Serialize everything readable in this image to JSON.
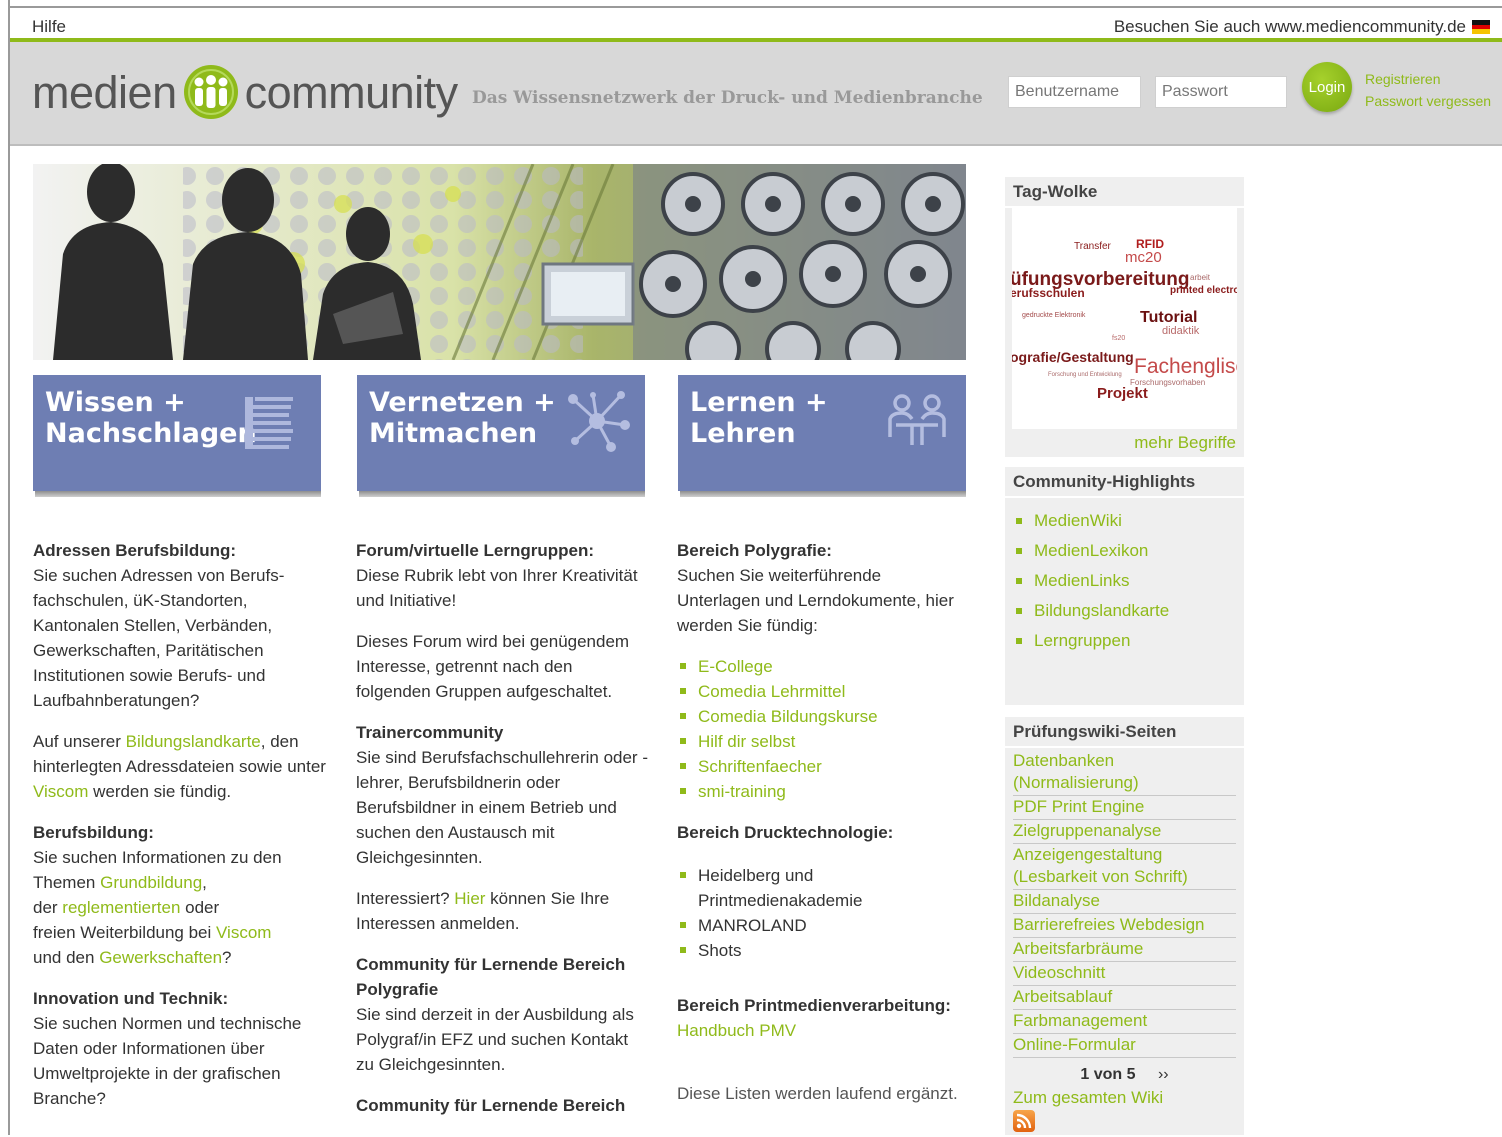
{
  "topbar": {
    "help": "Hilfe",
    "visit": "Besuchen Sie auch www.mediencommunity.de"
  },
  "header": {
    "logo_left": "medien",
    "logo_right": "community",
    "slogan": "Das Wissensnetzwerk der Druck- und Medienbranche",
    "username_placeholder": "Benutzername",
    "password_placeholder": "Passwort",
    "login": "Login",
    "register": "Registrieren",
    "forgot": "Passwort vergessen"
  },
  "tiles": [
    {
      "line1": "Wissen +",
      "line2": "Nachschlagen",
      "icon": "books-icon"
    },
    {
      "line1": "Vernetzen +",
      "line2": "Mitmachen",
      "icon": "network-icon"
    },
    {
      "line1": "Lernen +",
      "line2": "Lehren",
      "icon": "meeting-icon"
    }
  ],
  "col1": {
    "h1": "Adressen Berufsbildung:",
    "p1": "Sie suchen Adressen von Berufs- fachschulen, üK-Standorten, Kantonalen Stellen, Verbänden, Gewerkschaften, Paritätischen Institutionen sowie Berufs- und Laufbahnberatungen?",
    "p2_a": "Auf unserer ",
    "p2_link1": "Bildungslandkarte",
    "p2_b": ", den hinterlegten Adressdateien sowie unter ",
    "p2_link2": "Viscom",
    "p2_c": " werden sie fündig.",
    "h2": "Berufsbildung:",
    "p3_a": "Sie suchen Informationen zu den Themen ",
    "p3_link1": "Grundbildung",
    "p3_b": ",",
    "p3_c": "der ",
    "p3_link2": "reglementierten",
    "p3_d": " oder",
    "p3_e": "freien Weiterbildung bei ",
    "p3_link3": "Viscom",
    "p3_f": "und den ",
    "p3_link4": "Gewerkschaften",
    "p3_g": "?",
    "h3": "Innovation und Technik:",
    "p4": "Sie suchen Normen und technische Daten oder Informationen über Umweltprojekte in der grafischen Branche?"
  },
  "col2": {
    "h1": "Forum/virtuelle Lerngruppen:",
    "p1": "Diese Rubrik lebt von Ihrer Kreativität und Initiative!",
    "p2": "Dieses Forum wird bei genügendem Interesse, getrennt nach den folgenden Gruppen aufgeschaltet.",
    "h2": "Trainercommunity",
    "p3": "Sie sind Berufsfachschullehrerin oder -lehrer, Berufsbildnerin oder Berufsbildner in einem Betrieb und suchen den Austausch mit Gleichgesinnten.",
    "p4_a": "Interessiert? ",
    "p4_link": "Hier",
    "p4_b": " können Sie Ihre Interessen anmelden.",
    "h3": "Community für Lernende Bereich Polygrafie",
    "p5": "Sie sind derzeit in der Ausbildung als Polygraf/in EFZ und suchen Kontakt zu Gleichgesinnten.",
    "h4": "Community für Lernende Bereich"
  },
  "col3": {
    "h1": "Bereich Polygrafie:",
    "p1": "Suchen Sie weiterführende Unterlagen und Lerndokumente, hier werden Sie fündig:",
    "links1": [
      "E-College",
      "Comedia Lehrmittel",
      "Comedia Bildungskurse",
      "Hilf dir selbst",
      "Schriftenfaecher",
      "smi-training"
    ],
    "h2": "Bereich Drucktechnologie:",
    "items2": [
      "Heidelberg und Printmedienakademie",
      "MANROLAND",
      "Shots"
    ],
    "h3": "Bereich Printmedienverarbeitung:",
    "link3": "Handbuch PMV",
    "p4": "Diese Listen werden laufend ergänzt."
  },
  "sidebar": {
    "tag_title": "Tag-Wolke",
    "tags": [
      "Transfer",
      "RFID",
      "mc20",
      "üfungsvorbereitung",
      "erufsschulen",
      "printed electroni",
      "Tutorial",
      "didaktik",
      "gedruckte Elektronik",
      "ografie/Gestaltung",
      "Fachenglisc",
      "Projekt",
      "Forschung und Entwicklung",
      "Forschungsvorhaben",
      "fs20",
      "arbeit"
    ],
    "more": "mehr Begriffe",
    "hl_title": "Community-Highlights",
    "highlights": [
      "MedienWiki",
      "MedienLexikon",
      "MedienLinks",
      "Bildungslandkarte",
      "Lerngruppen"
    ],
    "wiki_title": "Prüfungswiki-Seiten",
    "wiki": [
      "Datenbanken (Normalisierung)",
      "PDF Print Engine",
      "Zielgruppenanalyse",
      "Anzeigengestaltung (Lesbarkeit von Schrift)",
      "Bildanalyse",
      "Barrierefreies Webdesign",
      "Arbeitsfarbräume",
      "Videoschnitt",
      "Arbeitsablauf",
      "Farbmanagement",
      "Online-Formular"
    ],
    "pager": "1 von 5",
    "next": "››",
    "all": "Zum gesamten Wiki"
  },
  "colors": {
    "accent": "#8fba1a",
    "tile": "#6e7eb3",
    "header_bg": "#d8d8d8",
    "tag": "#8a1c1c"
  }
}
